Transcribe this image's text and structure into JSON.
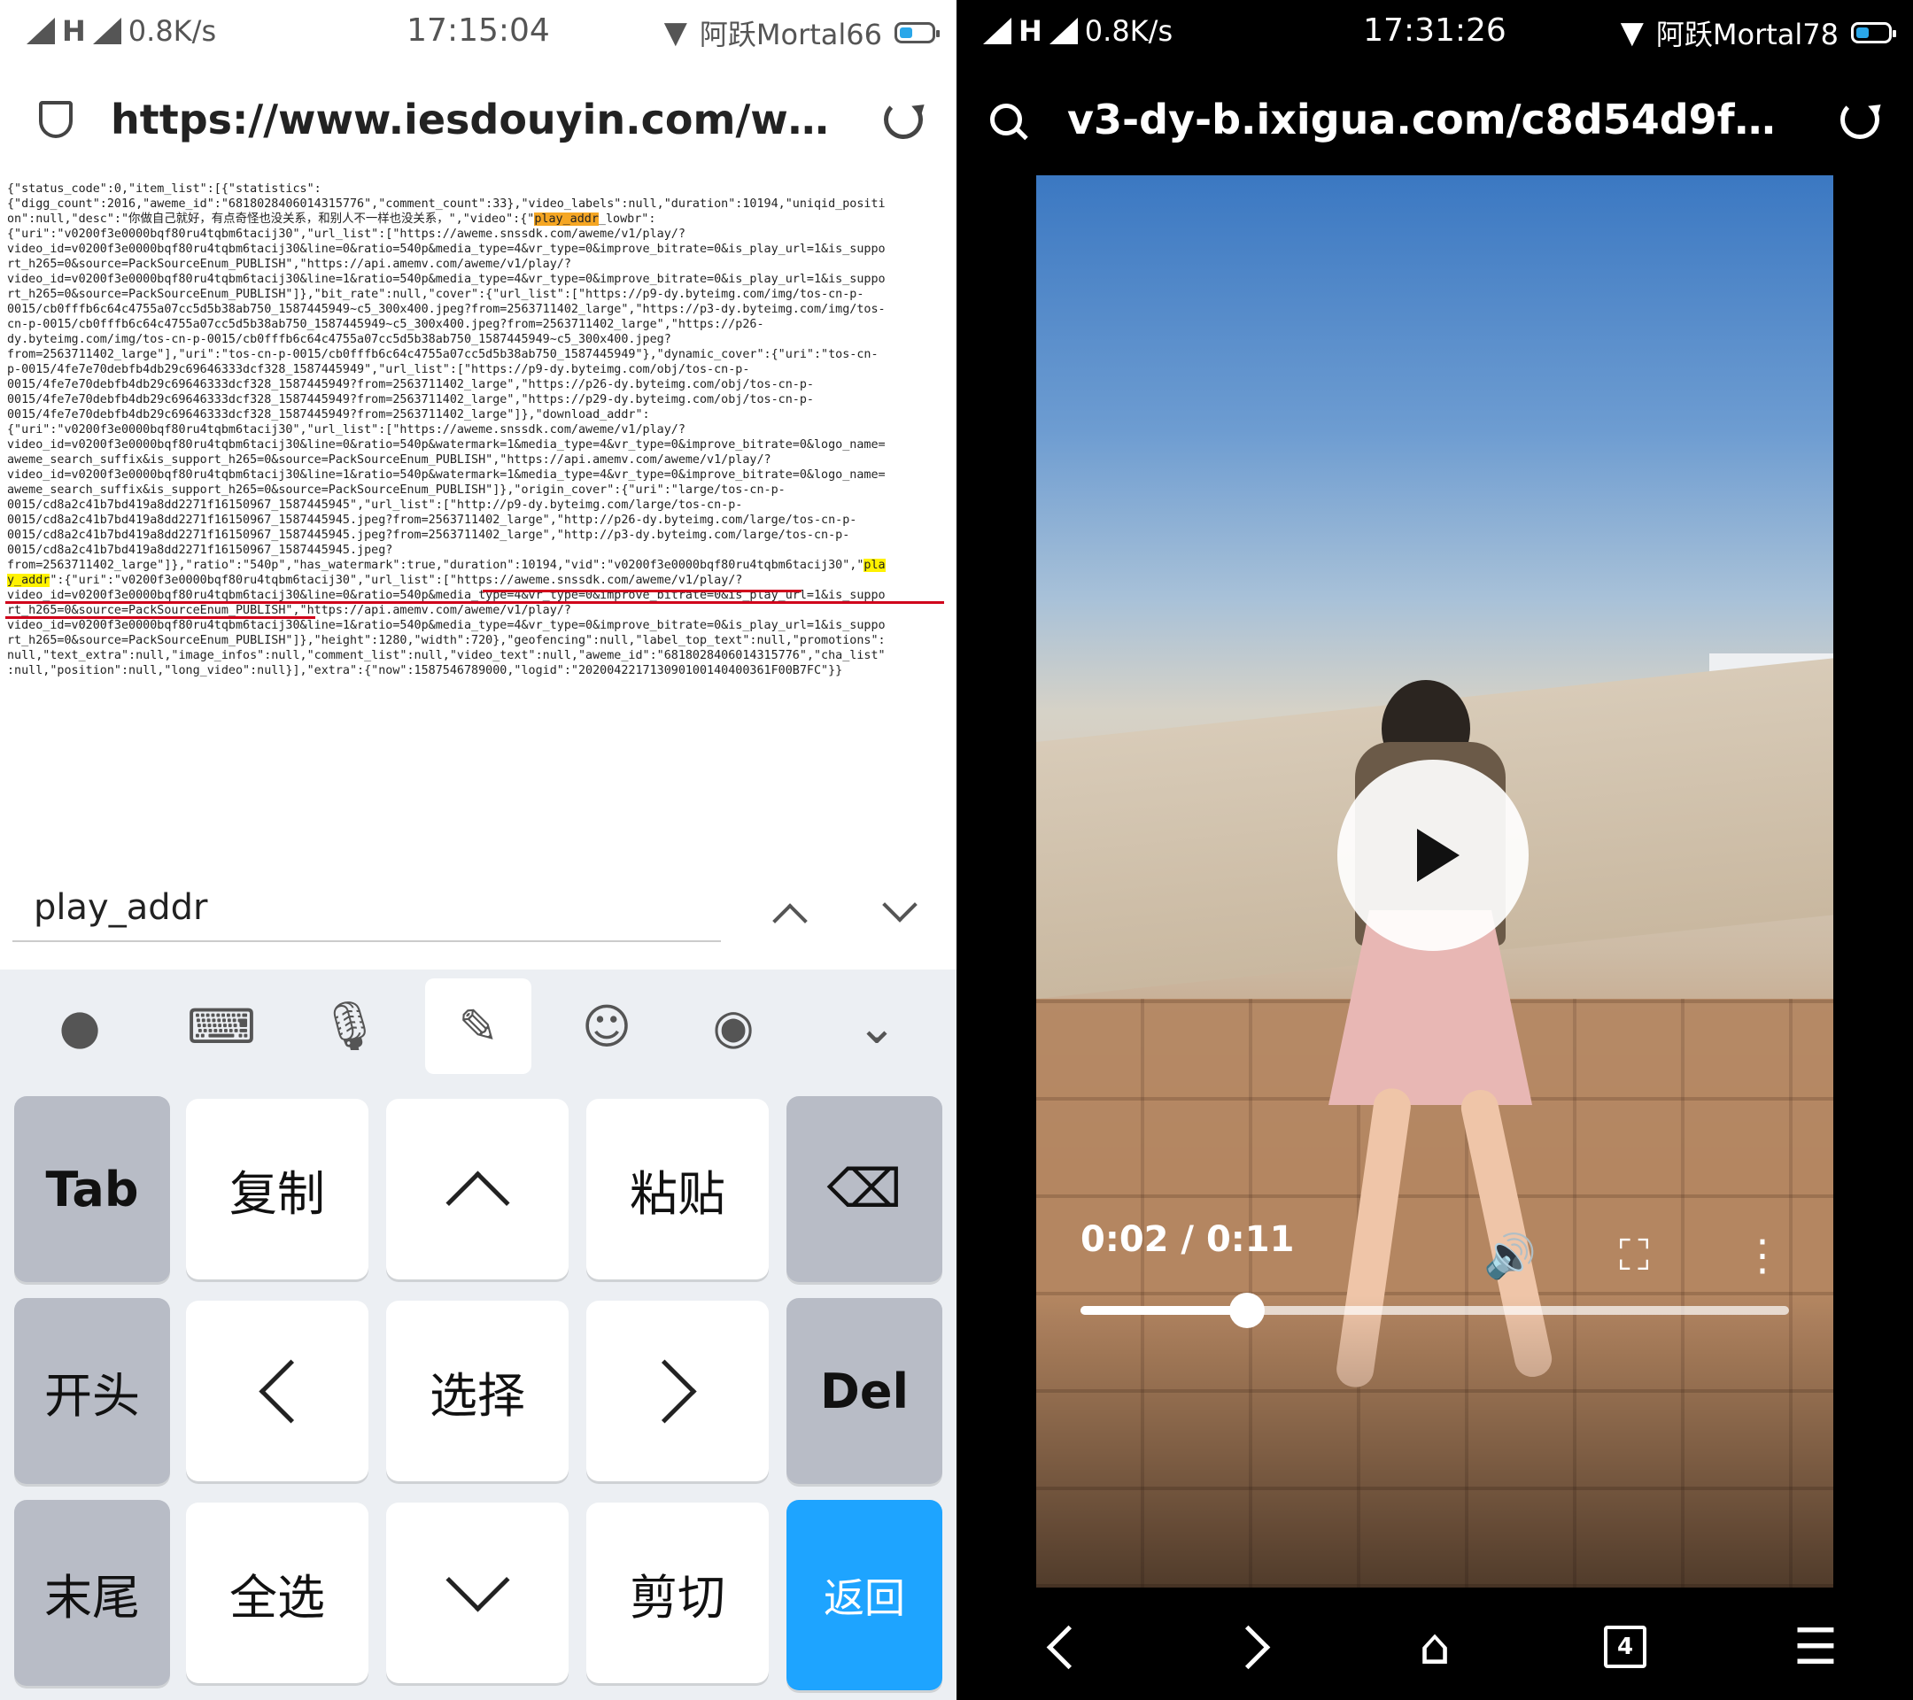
{
  "left": {
    "status": {
      "network": "H",
      "speed": "0.8K/s",
      "time": "17:15:04",
      "carrier": "阿跃Mortal66"
    },
    "address": {
      "url": "https://www.iesdouyin.com/web/api..."
    },
    "json_parts": {
      "p1": "{\"status_code\":0,\"item_list\":[{\"statistics\":\n{\"digg_count\":2016,\"aweme_id\":\"6818028406014315776\",\"comment_count\":33},\"video_labels\":null,\"duration\":10194,\"uniqid_positi\non\":null,\"desc\":\"你做自己就好，有点奇怪也没关系，和别人不一样也没关系，\",\"video\":{\"",
      "hl1": "play_addr",
      "p2": "_lowbr\":\n{\"uri\":\"v0200f3e0000bqf80ru4tqbm6tacij30\",\"url_list\":[\"https://aweme.snssdk.com/aweme/v1/play/?\nvideo_id=v0200f3e0000bqf80ru4tqbm6tacij30&line=0&ratio=540p&media_type=4&vr_type=0&improve_bitrate=0&is_play_url=1&is_suppo\nrt_h265=0&source=PackSourceEnum_PUBLISH\",\"https://api.amemv.com/aweme/v1/play/?\nvideo_id=v0200f3e0000bqf80ru4tqbm6tacij30&line=1&ratio=540p&media_type=4&vr_type=0&improve_bitrate=0&is_play_url=1&is_suppo\nrt_h265=0&source=PackSourceEnum_PUBLISH\"]},\"bit_rate\":null,\"cover\":{\"url_list\":[\"https://p9-dy.byteimg.com/img/tos-cn-p-\n0015/cb0fffb6c64c4755a07cc5d5b38ab750_1587445949~c5_300x400.jpeg?from=2563711402_large\",\"https://p3-dy.byteimg.com/img/tos-\ncn-p-0015/cb0fffb6c64c4755a07cc5d5b38ab750_1587445949~c5_300x400.jpeg?from=2563711402_large\",\"https://p26-\ndy.byteimg.com/img/tos-cn-p-0015/cb0fffb6c64c4755a07cc5d5b38ab750_1587445949~c5_300x400.jpeg?\nfrom=2563711402_large\"],\"uri\":\"tos-cn-p-0015/cb0fffb6c64c4755a07cc5d5b38ab750_1587445949\"},\"dynamic_cover\":{\"uri\":\"tos-cn-\np-0015/4fe7e70debfb4db29c69646333dcf328_1587445949\",\"url_list\":[\"https://p9-dy.byteimg.com/obj/tos-cn-p-\n0015/4fe7e70debfb4db29c69646333dcf328_1587445949?from=2563711402_large\",\"https://p26-dy.byteimg.com/obj/tos-cn-p-\n0015/4fe7e70debfb4db29c69646333dcf328_1587445949?from=2563711402_large\",\"https://p29-dy.byteimg.com/obj/tos-cn-p-\n0015/4fe7e70debfb4db29c69646333dcf328_1587445949?from=2563711402_large\"]},\"download_addr\":\n{\"uri\":\"v0200f3e0000bqf80ru4tqbm6tacij30\",\"url_list\":[\"https://aweme.snssdk.com/aweme/v1/play/?\nvideo_id=v0200f3e0000bqf80ru4tqbm6tacij30&line=0&ratio=540p&watermark=1&media_type=4&vr_type=0&improve_bitrate=0&logo_name=\naweme_search_suffix&is_support_h265=0&source=PackSourceEnum_PUBLISH\",\"https://api.amemv.com/aweme/v1/play/?\nvideo_id=v0200f3e0000bqf80ru4tqbm6tacij30&line=1&ratio=540p&watermark=1&media_type=4&vr_type=0&improve_bitrate=0&logo_name=\naweme_search_suffix&is_support_h265=0&source=PackSourceEnum_PUBLISH\"]},\"origin_cover\":{\"uri\":\"large/tos-cn-p-\n0015/cd8a2c41b7bd419a8dd2271f16150967_1587445945\",\"url_list\":[\"http://p9-dy.byteimg.com/large/tos-cn-p-\n0015/cd8a2c41b7bd419a8dd2271f16150967_1587445945.jpeg?from=2563711402_large\",\"http://p26-dy.byteimg.com/large/tos-cn-p-\n0015/cd8a2c41b7bd419a8dd2271f16150967_1587445945.jpeg?from=2563711402_large\",\"http://p3-dy.byteimg.com/large/tos-cn-p-\n0015/cd8a2c41b7bd419a8dd2271f16150967_1587445945.jpeg?\nfrom=2563711402_large\"]},\"ratio\":\"540p\",\"has_watermark\":true,\"duration\":10194,\"vid\":\"v0200f3e0000bqf80ru4tqbm6tacij30\",\"",
      "hl2": "pla\ny_addr",
      "p3": "\":{\"uri\":\"v0200f3e0000bqf80ru4tqbm6tacij30\",\"url_list\":[\"https://aweme.snssdk.com/aweme/v1/play/?\nvideo_id=v0200f3e0000bqf80ru4tqbm6tacij30&line=0&ratio=540p&media_type=4&vr_type=0&improve_bitrate=0&is_play_url=1&is_suppo\nrt_h265=0&source=PackSourceEnum_PUBLISH\",\"https://api.amemv.com/aweme/v1/play/?\nvideo_id=v0200f3e0000bqf80ru4tqbm6tacij30&line=1&ratio=540p&media_type=4&vr_type=0&improve_bitrate=0&is_play_url=1&is_suppo\nrt_h265=0&source=PackSourceEnum_PUBLISH\"]},\"height\":1280,\"width\":720},\"geofencing\":null,\"label_top_text\":null,\"promotions\":\nnull,\"text_extra\":null,\"image_infos\":null,\"comment_list\":null,\"video_text\":null,\"aweme_id\":\"6818028406014315776\",\"cha_list\"\n:null,\"position\":null,\"long_video\":null}],\"extra\":{\"now\":1587546789000,\"logid\":\"20200422171309010014040036​1F00B7FC\"}}"
    },
    "find": {
      "query": "play_addr"
    },
    "keys": {
      "tab": "Tab",
      "copy": "复制",
      "paste": "粘贴",
      "home": "开头",
      "select": "选择",
      "del": "Del",
      "end": "末尾",
      "select_all": "全选",
      "cut": "剪切",
      "return": "返回"
    }
  },
  "right": {
    "status": {
      "network": "H",
      "speed": "0.8K/s",
      "time": "17:31:26",
      "carrier": "阿跃Mortal78"
    },
    "address": {
      "url": "v3-dy-b.ixigua.com/c8d54d9f99e18..."
    },
    "player": {
      "time": "0:02 / 0:11",
      "progress": 0.235
    },
    "nav": {
      "tab_count": "4"
    }
  },
  "colors": {
    "find_highlight_current": "#f5a623",
    "find_highlight": "#fff200",
    "key_blue": "#1ea4ff"
  }
}
